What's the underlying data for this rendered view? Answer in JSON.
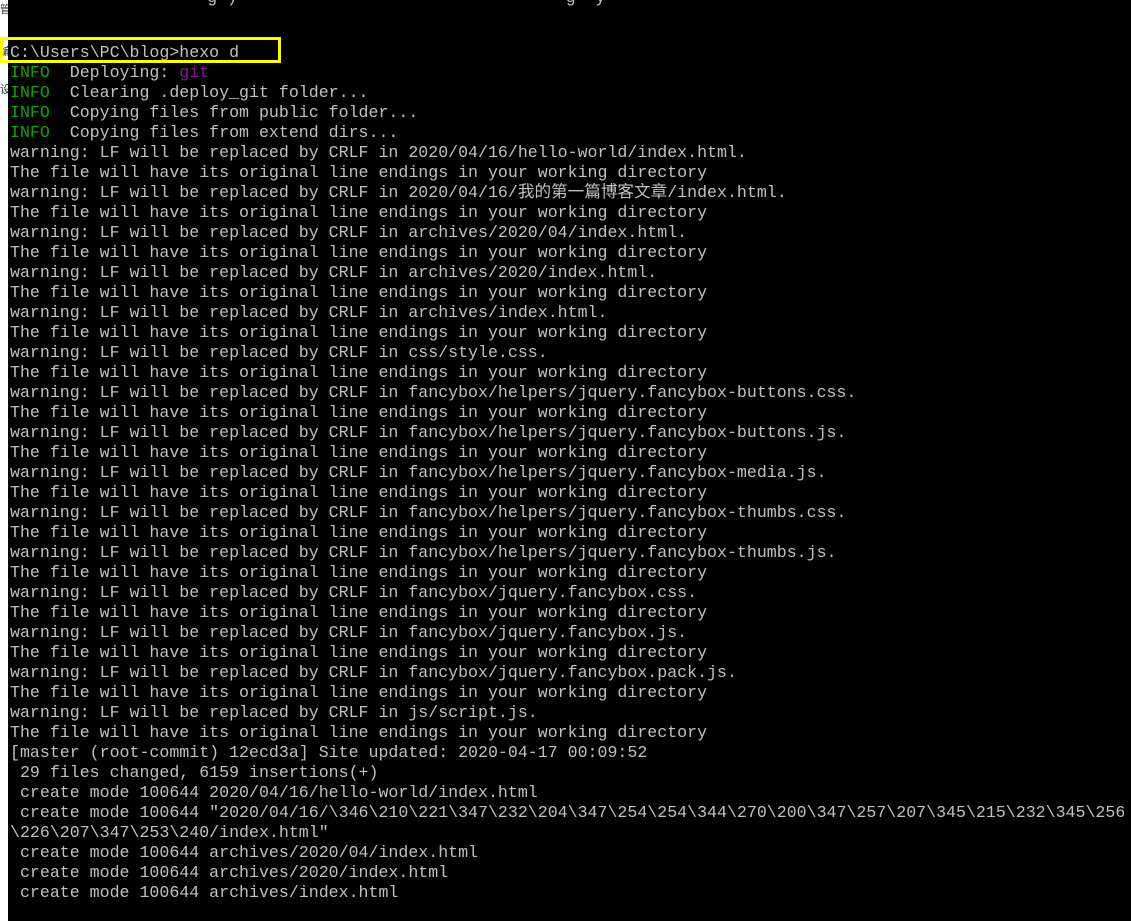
{
  "left_strip": {
    "glyphs": [
      "管",
      "编",
      "设"
    ]
  },
  "terminal": {
    "top_cut_text": "                    g )                                 g  y",
    "prompt_line": "C:\\Users\\PC\\blog>hexo d",
    "info_lines": [
      {
        "tag": "INFO",
        "text": "  Deploying: ",
        "highlight": "git"
      },
      {
        "tag": "INFO",
        "text": "  Clearing .deploy_git folder...",
        "highlight": ""
      },
      {
        "tag": "INFO",
        "text": "  Copying files from public folder...",
        "highlight": ""
      },
      {
        "tag": "INFO",
        "text": "  Copying files from extend dirs...",
        "highlight": ""
      }
    ],
    "output_lines": [
      "warning: LF will be replaced by CRLF in 2020/04/16/hello-world/index.html.",
      "The file will have its original line endings in your working directory",
      "warning: LF will be replaced by CRLF in 2020/04/16/我的第一篇博客文章/index.html.",
      "The file will have its original line endings in your working directory",
      "warning: LF will be replaced by CRLF in archives/2020/04/index.html.",
      "The file will have its original line endings in your working directory",
      "warning: LF will be replaced by CRLF in archives/2020/index.html.",
      "The file will have its original line endings in your working directory",
      "warning: LF will be replaced by CRLF in archives/index.html.",
      "The file will have its original line endings in your working directory",
      "warning: LF will be replaced by CRLF in css/style.css.",
      "The file will have its original line endings in your working directory",
      "warning: LF will be replaced by CRLF in fancybox/helpers/jquery.fancybox-buttons.css.",
      "The file will have its original line endings in your working directory",
      "warning: LF will be replaced by CRLF in fancybox/helpers/jquery.fancybox-buttons.js.",
      "The file will have its original line endings in your working directory",
      "warning: LF will be replaced by CRLF in fancybox/helpers/jquery.fancybox-media.js.",
      "The file will have its original line endings in your working directory",
      "warning: LF will be replaced by CRLF in fancybox/helpers/jquery.fancybox-thumbs.css.",
      "The file will have its original line endings in your working directory",
      "warning: LF will be replaced by CRLF in fancybox/helpers/jquery.fancybox-thumbs.js.",
      "The file will have its original line endings in your working directory",
      "warning: LF will be replaced by CRLF in fancybox/jquery.fancybox.css.",
      "The file will have its original line endings in your working directory",
      "warning: LF will be replaced by CRLF in fancybox/jquery.fancybox.js.",
      "The file will have its original line endings in your working directory",
      "warning: LF will be replaced by CRLF in fancybox/jquery.fancybox.pack.js.",
      "The file will have its original line endings in your working directory",
      "warning: LF will be replaced by CRLF in js/script.js.",
      "The file will have its original line endings in your working directory",
      "[master (root-commit) 12ecd3a] Site updated: 2020-04-17 00:09:52",
      " 29 files changed, 6159 insertions(+)",
      " create mode 100644 2020/04/16/hello-world/index.html",
      " create mode 100644 \"2020/04/16/\\346\\210\\221\\347\\232\\204\\347\\254\\254\\344\\270\\200\\347\\257\\207\\345\\215\\232\\345\\256",
      "\\226\\207\\347\\253\\240/index.html\"",
      " create mode 100644 archives/2020/04/index.html",
      " create mode 100644 archives/2020/index.html",
      " create mode 100644 archives/index.html"
    ]
  },
  "colors": {
    "background": "#000000",
    "text": "#c0c0c0",
    "info": "#13a10e",
    "git": "#881798",
    "highlight_box": "#ffff00"
  }
}
